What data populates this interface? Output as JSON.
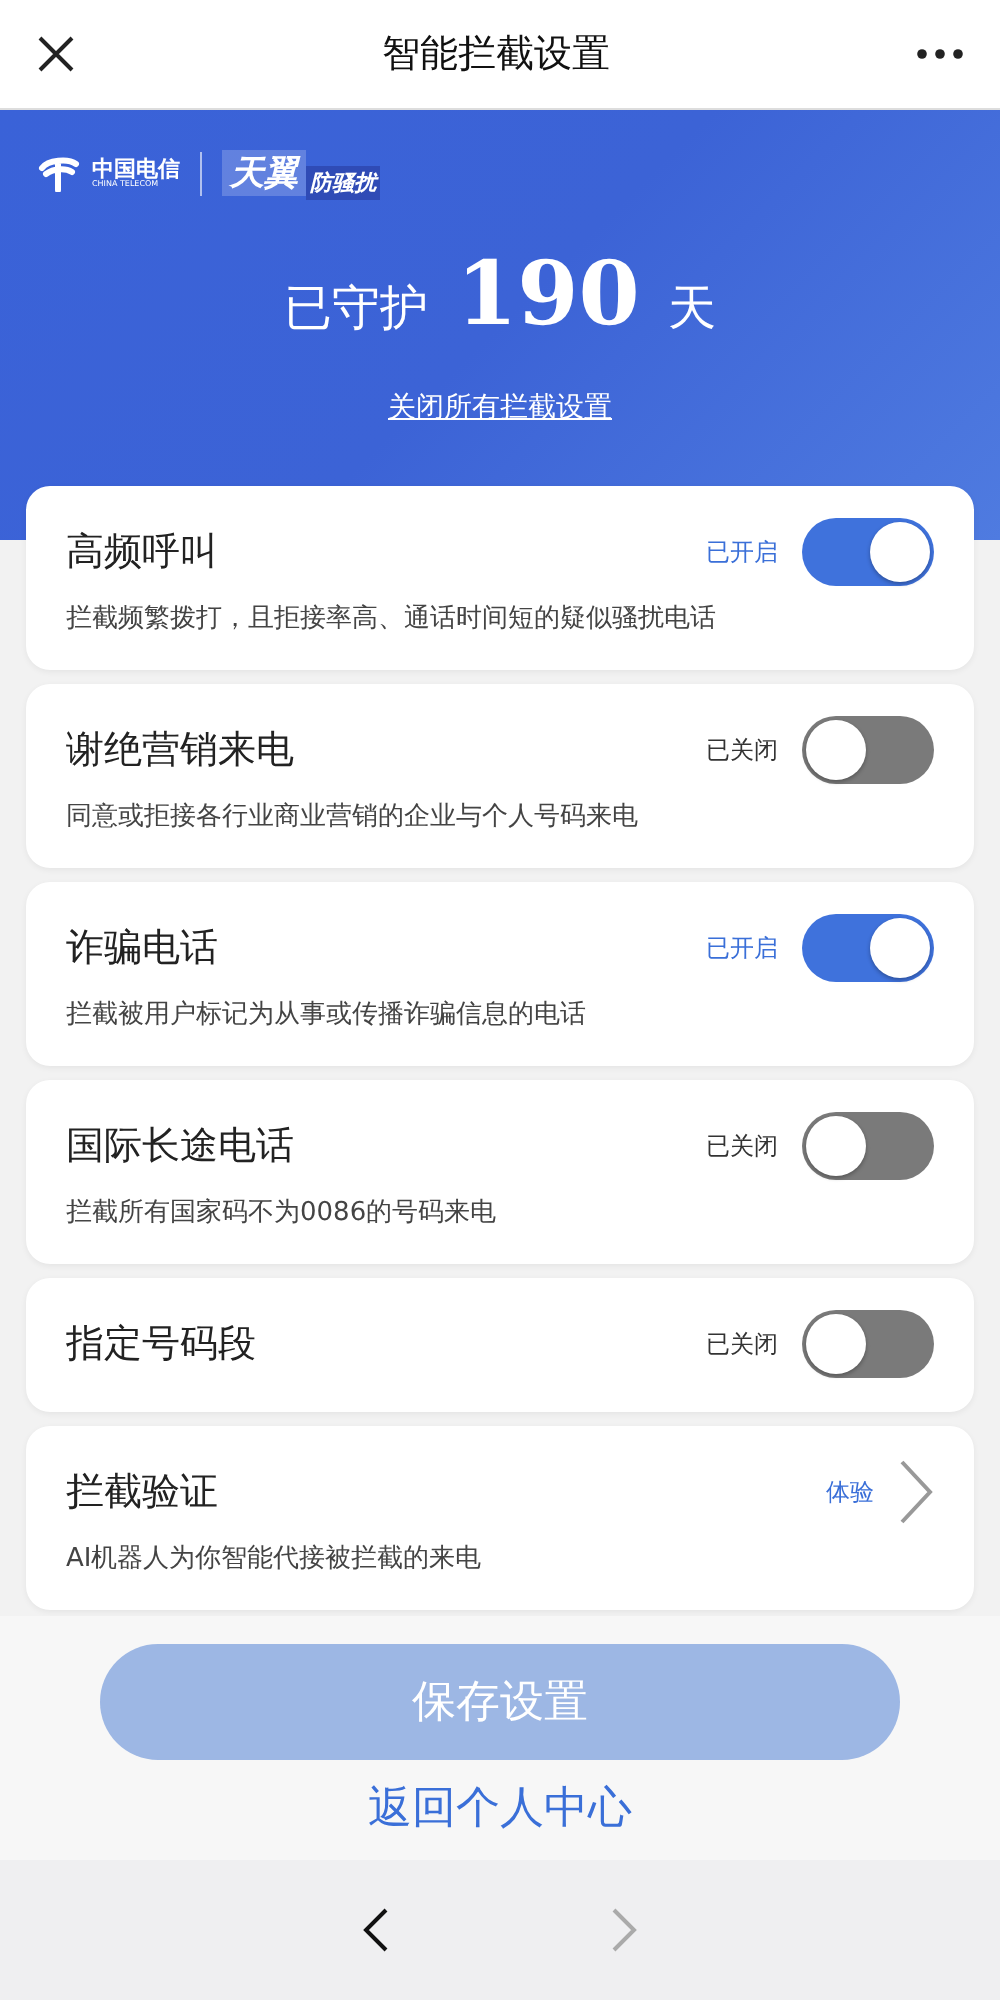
{
  "nav": {
    "title": "智能拦截设置"
  },
  "banner": {
    "logo": {
      "brand_cn": "中国电信",
      "brand_en": "CHINA TELECOM",
      "product": "天翼",
      "product_sub": "防骚扰"
    },
    "guard_prefix": "已守护",
    "guard_days": "190",
    "guard_suffix": "天",
    "close_all_link": "关闭所有拦截设置"
  },
  "settings": [
    {
      "kind": "toggle",
      "title": "高频呼叫",
      "status": "已开启",
      "on": true,
      "description": "拦截频繁拨打，且拒接率高、通话时间短的疑似骚扰电话"
    },
    {
      "kind": "toggle",
      "title": "谢绝营销来电",
      "status": "已关闭",
      "on": false,
      "description": "同意或拒接各行业商业营销的企业与个人号码来电"
    },
    {
      "kind": "toggle",
      "title": "诈骗电话",
      "status": "已开启",
      "on": true,
      "description": "拦截被用户标记为从事或传播诈骗信息的电话"
    },
    {
      "kind": "toggle",
      "title": "国际长途电话",
      "status": "已关闭",
      "on": false,
      "description": "拦截所有国家码不为0086的号码来电"
    },
    {
      "kind": "toggle",
      "title": "指定号码段",
      "status": "已关闭",
      "on": false
    },
    {
      "kind": "link",
      "title": "拦截验证",
      "status": "体验",
      "description": "AI机器人为你智能代接被拦截的来电"
    }
  ],
  "footer": {
    "save_button": {
      "label": "保存设置",
      "disabled": true
    },
    "back_link": "返回个人中心"
  },
  "browser_bar": {
    "back_disabled": false,
    "forward_disabled": true
  }
}
